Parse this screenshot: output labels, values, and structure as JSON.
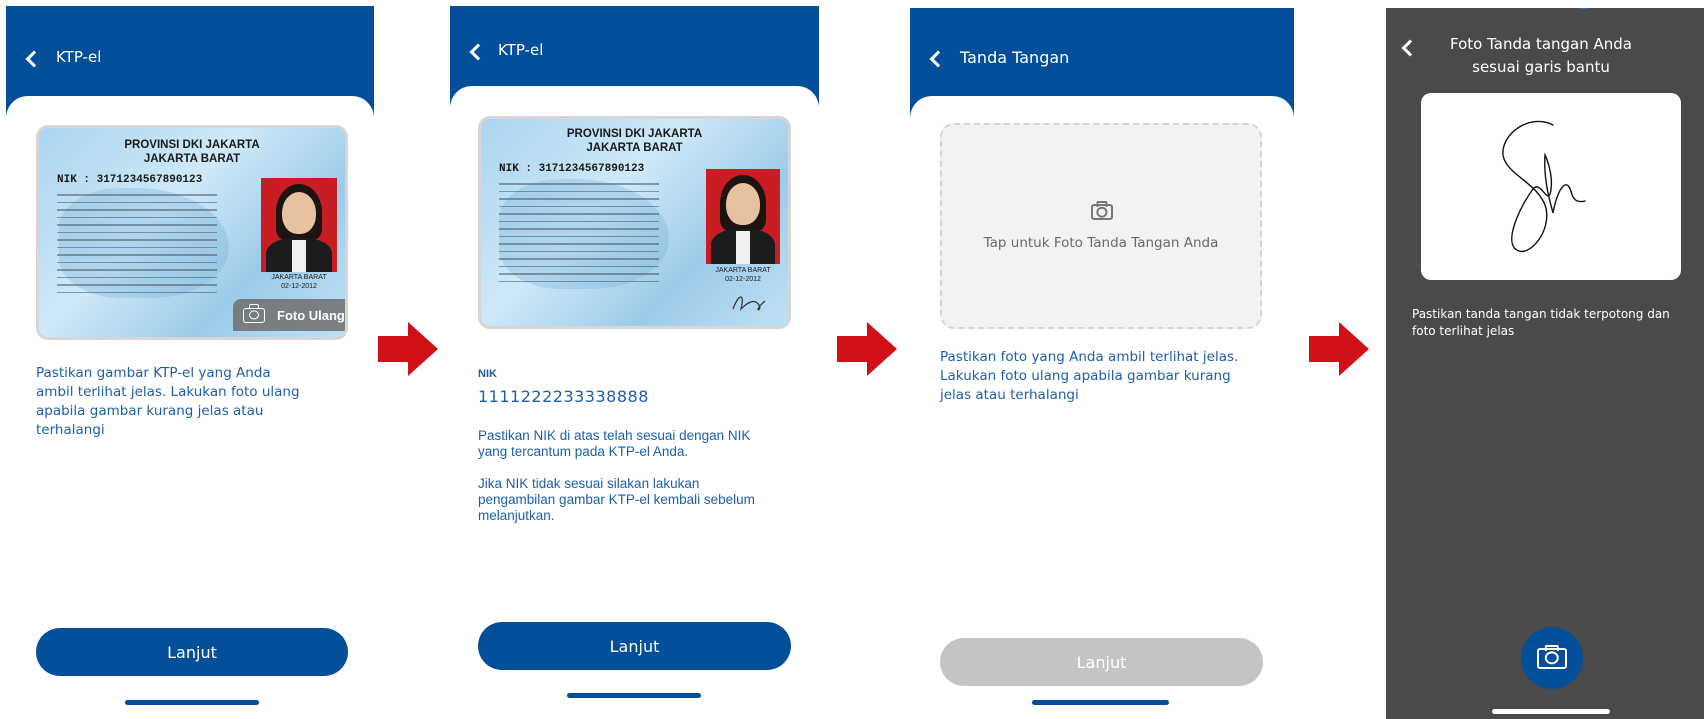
{
  "colors": {
    "primary": "#044f9a",
    "text_blue": "#1d5fa8",
    "arrow": "#d10f17",
    "disabled": "#c4c4c4",
    "dark_bg": "#4a4a4a"
  },
  "screen1": {
    "title": "KTP-el",
    "retake_label": "Foto Ulang",
    "instruction": "Pastikan gambar KTP-el yang Anda ambil terlihat jelas. Lakukan foto ulang apabila gambar kurang jelas atau terhalangi",
    "next_label": "Lanjut"
  },
  "screen2": {
    "title": "KTP-el",
    "nik_label": "NIK",
    "nik_value": "1111222233338888",
    "note1": "Pastikan NIK di atas telah sesuai dengan NIK yang tercantum pada KTP-el Anda.",
    "note2": "Jika NIK tidak sesuai silakan lakukan pengambilan gambar KTP-el kembali sebelum melanjutkan.",
    "next_label": "Lanjut"
  },
  "screen3": {
    "title": "Tanda Tangan",
    "tap_text": "Tap untuk Foto Tanda Tangan Anda",
    "instruction": "Pastikan foto yang Anda ambil terlihat jelas. Lakukan foto ulang apabila gambar kurang jelas atau terhalangi",
    "next_label": "Lanjut"
  },
  "screen4": {
    "title": "Foto Tanda tangan Anda sesuai garis bantu",
    "hint": "Pastikan tanda tangan tidak terpotong dan foto terlihat jelas"
  },
  "ktp_card": {
    "province": "PROVINSI DKI JAKARTA",
    "city": "JAKARTA BARAT",
    "nik_line": "NIK      : 3171234567890123",
    "issue_place": "JAKARTA BARAT",
    "issue_date": "02-12-2012"
  },
  "icons": [
    "back-arrow-icon",
    "camera-icon",
    "red-arrow-icon"
  ]
}
